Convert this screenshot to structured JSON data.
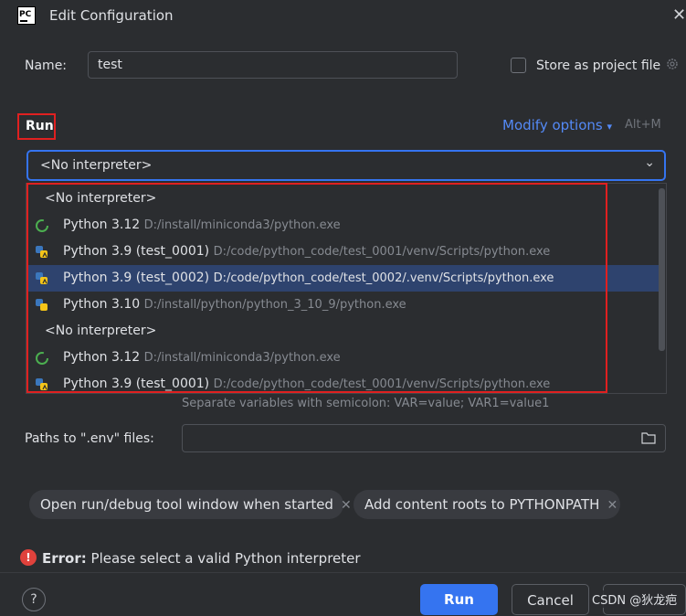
{
  "window": {
    "title": "Edit Configuration",
    "app_icon": "pycharm-logo",
    "app_icon_text": "PC"
  },
  "name_field": {
    "label": "Name:",
    "value": "test"
  },
  "store": {
    "label": "Store as project file",
    "checked": false
  },
  "run_section": {
    "title": "Run",
    "modify_options": "Modify options",
    "shortcut": "Alt+M"
  },
  "interpreter": {
    "selected": "<No interpreter>",
    "options": [
      {
        "type": "none",
        "label": "<No interpreter>"
      },
      {
        "type": "conda",
        "name": "Python 3.12",
        "path": "D:/install/miniconda3/python.exe",
        "icon": "conda-icon"
      },
      {
        "type": "venv",
        "name": "Python 3.9 (test_0001)",
        "path": "D:/code/python_code/test_0001/venv/Scripts/python.exe",
        "icon": "python-venv-icon"
      },
      {
        "type": "venv",
        "name": "Python 3.9 (test_0002)",
        "path": "D:/code/python_code/test_0002/.venv/Scripts/python.exe",
        "icon": "python-venv-icon",
        "highlighted": true
      },
      {
        "type": "python",
        "name": "Python 3.10",
        "path": "D:/install/python/python_3_10_9/python.exe",
        "icon": "python-icon"
      },
      {
        "type": "none",
        "label": "<No interpreter>"
      },
      {
        "type": "conda",
        "name": "Python 3.12",
        "path": "D:/install/miniconda3/python.exe",
        "icon": "conda-icon"
      },
      {
        "type": "venv",
        "name": "Python 3.9 (test_0001)",
        "path": "D:/code/python_code/test_0001/venv/Scripts/python.exe",
        "icon": "python-venv-icon"
      }
    ]
  },
  "env_hint": "Separate variables with semicolon: VAR=value; VAR1=value1",
  "env_files": {
    "label": "Paths to \".env\" files:",
    "value": ""
  },
  "chips": [
    {
      "label": "Open run/debug tool window when started"
    },
    {
      "label": "Add content roots to PYTHONPATH"
    }
  ],
  "error": {
    "prefix": "Error:",
    "message": "Please select a valid Python interpreter"
  },
  "buttons": {
    "help": "?",
    "run": "Run",
    "cancel": "Cancel",
    "apply": ""
  },
  "watermark": "CSDN @狄龙疤",
  "colors": {
    "background": "#2b2d30",
    "accent": "#3574f0",
    "link": "#548af7",
    "selection": "#2e436e",
    "error": "#e0423c"
  }
}
